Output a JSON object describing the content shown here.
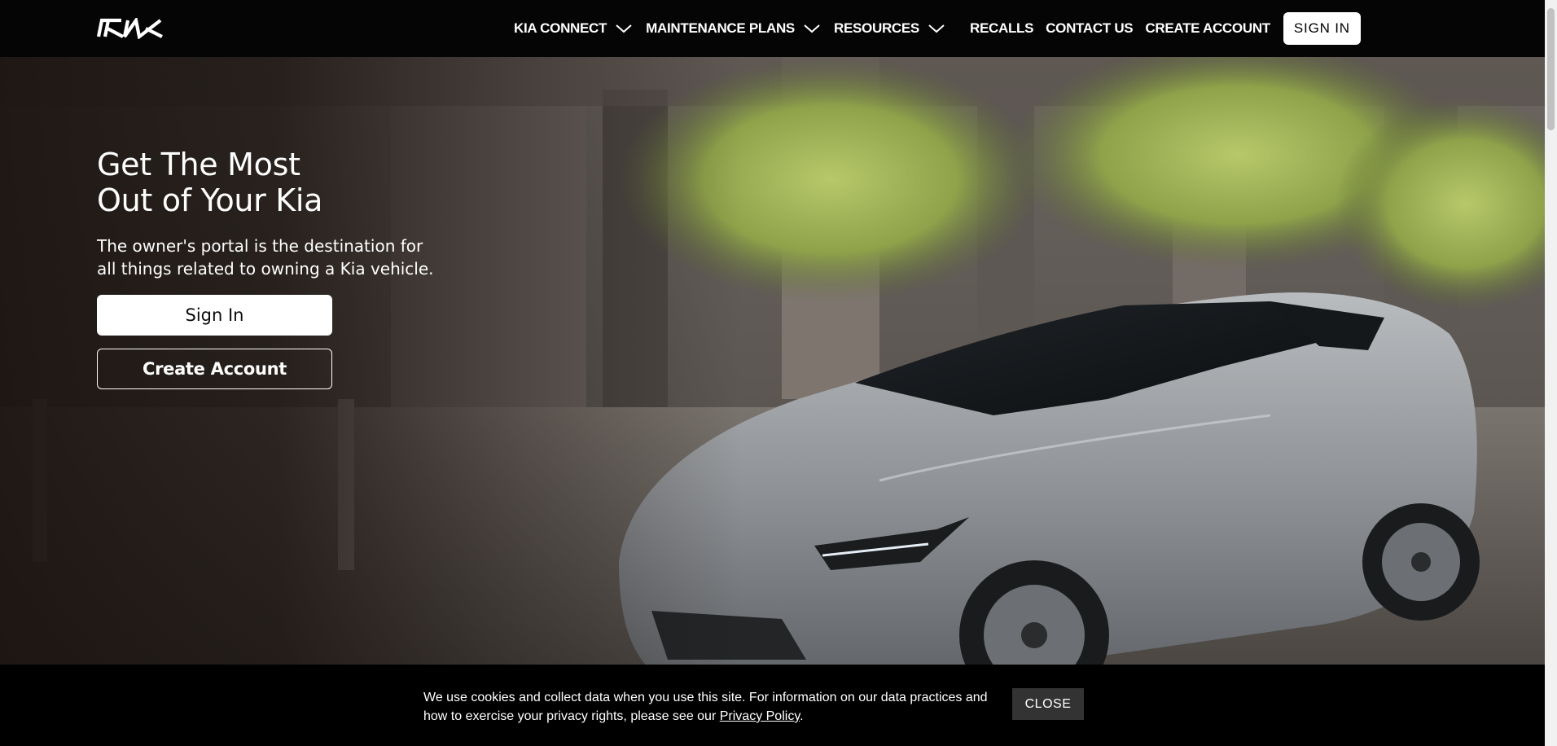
{
  "header": {
    "logo_text": "KIA",
    "nav": [
      {
        "label": "KIA CONNECT",
        "has_dropdown": true,
        "icon": "chevron-down-icon"
      },
      {
        "label": "MAINTENANCE PLANS",
        "has_dropdown": true,
        "icon": "chevron-down-icon"
      },
      {
        "label": "RESOURCES",
        "has_dropdown": true,
        "icon": "chevron-down-icon"
      },
      {
        "label": "RECALLS",
        "has_dropdown": false
      },
      {
        "label": "CONTACT US",
        "has_dropdown": false
      },
      {
        "label": "CREATE ACCOUNT",
        "has_dropdown": false
      }
    ],
    "sign_in_label": "SIGN IN"
  },
  "hero": {
    "title_line1": "Get The Most",
    "title_line2": "Out of Your Kia",
    "subtitle": "The owner's portal is the destination for all things related to owning a Kia vehicle.",
    "primary_button": "Sign In",
    "secondary_button": "Create Account"
  },
  "cookie_banner": {
    "text": "We use cookies and collect data when you use this site. For information on our data practices and how to exercise your privacy rights, please see our",
    "link_text": "Privacy Policy",
    "suffix": ".",
    "close_label": "CLOSE"
  },
  "colors": {
    "header_bg": "#050505",
    "banner_bg": "#000000",
    "close_button_bg": "#333333",
    "text_light": "#ffffff"
  }
}
